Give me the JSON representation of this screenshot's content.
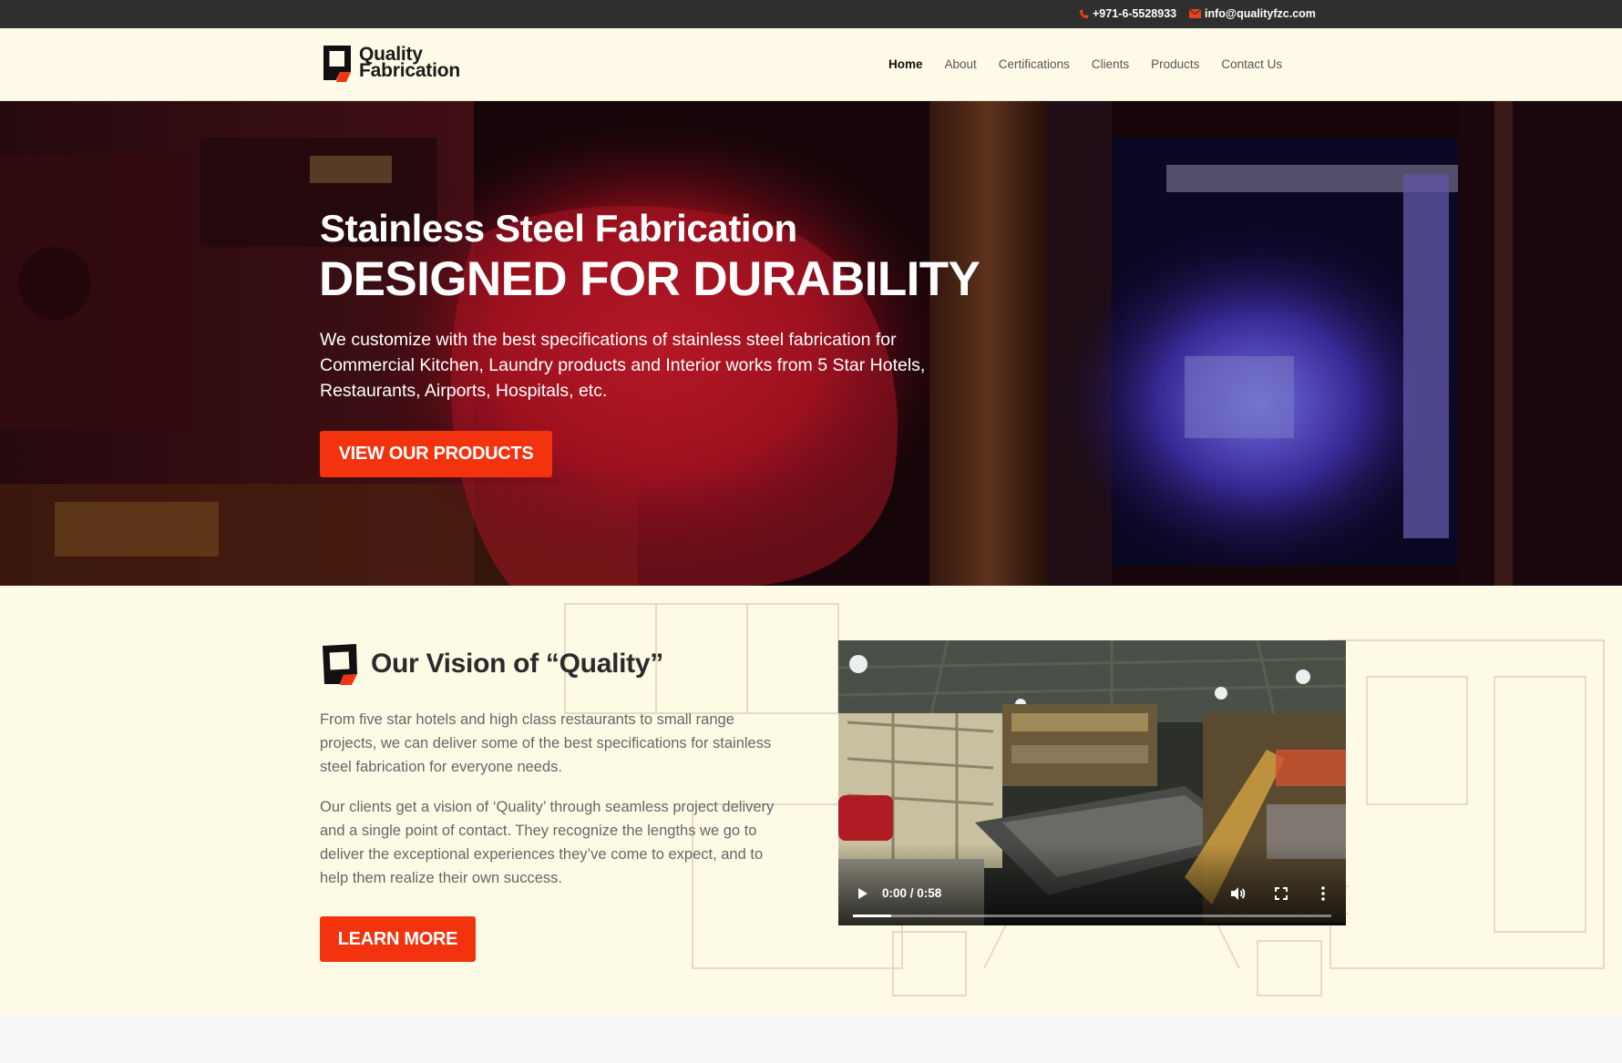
{
  "topbar": {
    "phone": "+971-6-5528933",
    "email": "info@qualityfzc.com",
    "phone_icon": "phone-icon",
    "email_icon": "envelope-icon"
  },
  "header": {
    "logo_line1": "Quality",
    "logo_line2": "Fabrication",
    "nav": [
      "Home",
      "About",
      "Certifications",
      "Clients",
      "Products",
      "Contact Us"
    ],
    "active": "Home"
  },
  "hero": {
    "title": "Stainless Steel Fabrication",
    "subtitle": "DESIGNED FOR DURABILITY",
    "text": "We customize with the best specifications of stainless steel fabrication for Commercial Kitchen, Laundry products and Interior works from 5 Star Hotels, Restaurants, Airports, Hospitals, etc.",
    "button": "VIEW OUR PRODUCTS"
  },
  "vision": {
    "title": "Our Vision of “Quality”",
    "p1": "From five star hotels and high class restaurants to small range projects, we can deliver some of the best specifications for stainless steel fabrication for everyone needs.",
    "p2": "Our clients get a vision of ‘Quality’ through seamless project delivery and a single point of contact. They recognize the lengths we go to deliver the exceptional experiences they’ve come to expect, and to help them realize their own success.",
    "button": "LEARN MORE"
  },
  "video": {
    "time": "0:00 / 0:58",
    "progress": 0.08
  },
  "colors": {
    "accent": "#f2330d",
    "topbar": "#2f2f2f",
    "header_bg": "#fffbe8",
    "section_bg": "#fdfbe6"
  }
}
